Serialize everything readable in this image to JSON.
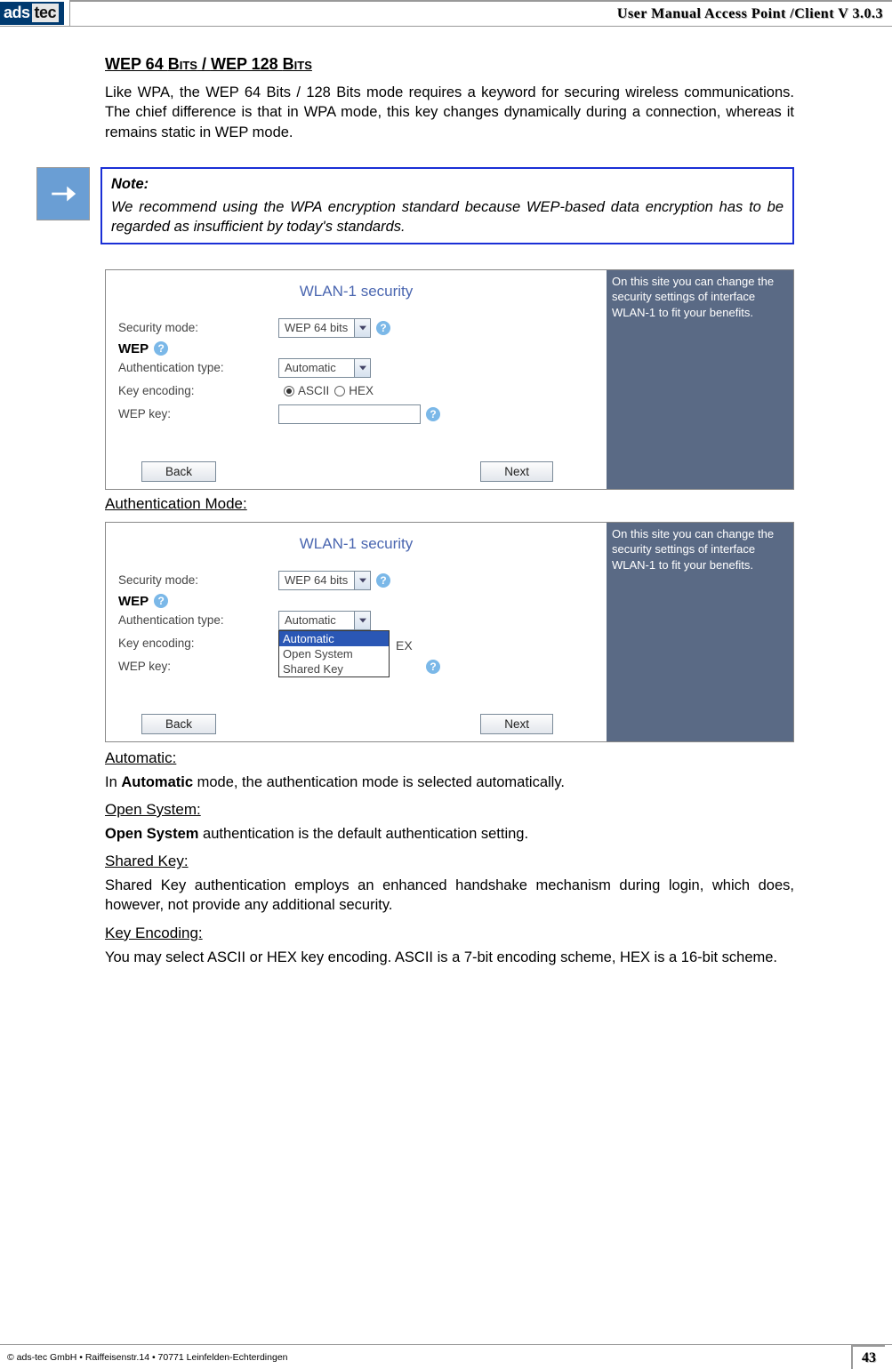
{
  "header": {
    "logo_left": "ads",
    "logo_right": "tec",
    "title": "User Manual Access  Point /Client V 3.0.3"
  },
  "section_heading": {
    "wep": "WEP 64 ",
    "bits": "Bits",
    "sep": " / ",
    "wep128": "WEP 128 ",
    "bits2": "Bits"
  },
  "intro_para": "Like WPA, the WEP 64 Bits / 128 Bits mode requires a keyword for securing wireless communications. The chief difference is that in WPA mode, this key changes dynamically during a connection, whereas it remains static in WEP mode.",
  "note": {
    "label": "Note:",
    "text": "We recommend using the WPA encryption standard because WEP-based data encryption has to be regarded as insufficient by today's standards."
  },
  "hint_text": "On this site you can change the security settings of interface WLAN-1 to fit your benefits.",
  "panel": {
    "title": "WLAN-1 security",
    "rows": {
      "security_mode": "Security mode:",
      "wep_label": "WEP",
      "auth_type": "Authentication type:",
      "key_encoding": "Key encoding:",
      "wep_key": "WEP key:"
    },
    "values": {
      "security_mode": "WEP 64 bits",
      "auth_type": "Automatic",
      "ascii": "ASCII",
      "hex": "HEX"
    },
    "buttons": {
      "back": "Back",
      "next": "Next"
    },
    "dropdown_options": [
      "Automatic",
      "Open System",
      "Shared Key"
    ],
    "ex_suffix": "EX"
  },
  "auth_mode_heading": "Authentication Mode:",
  "sections": {
    "automatic_h": "Automatic:",
    "automatic_p_pre": "In ",
    "automatic_p_b": "Automatic",
    "automatic_p_post": " mode, the authentication mode is selected automatically.",
    "open_h": "Open System:",
    "open_p_b": "Open System",
    "open_p_post": " authentication is the default authentication setting.",
    "shared_h": "Shared Key:",
    "shared_p": "Shared Key authentication employs an enhanced handshake mechanism during login, which does, however, not provide any additional security.",
    "keyenc_h": "Key Encoding:",
    "keyenc_p": "You may select ASCII or HEX key encoding. ASCII is a 7-bit encoding scheme, HEX is a 16-bit scheme."
  },
  "footer": {
    "copy": "© ads-tec GmbH • Raiffeisenstr.14 • 70771 Leinfelden-Echterdingen",
    "page": "43"
  }
}
